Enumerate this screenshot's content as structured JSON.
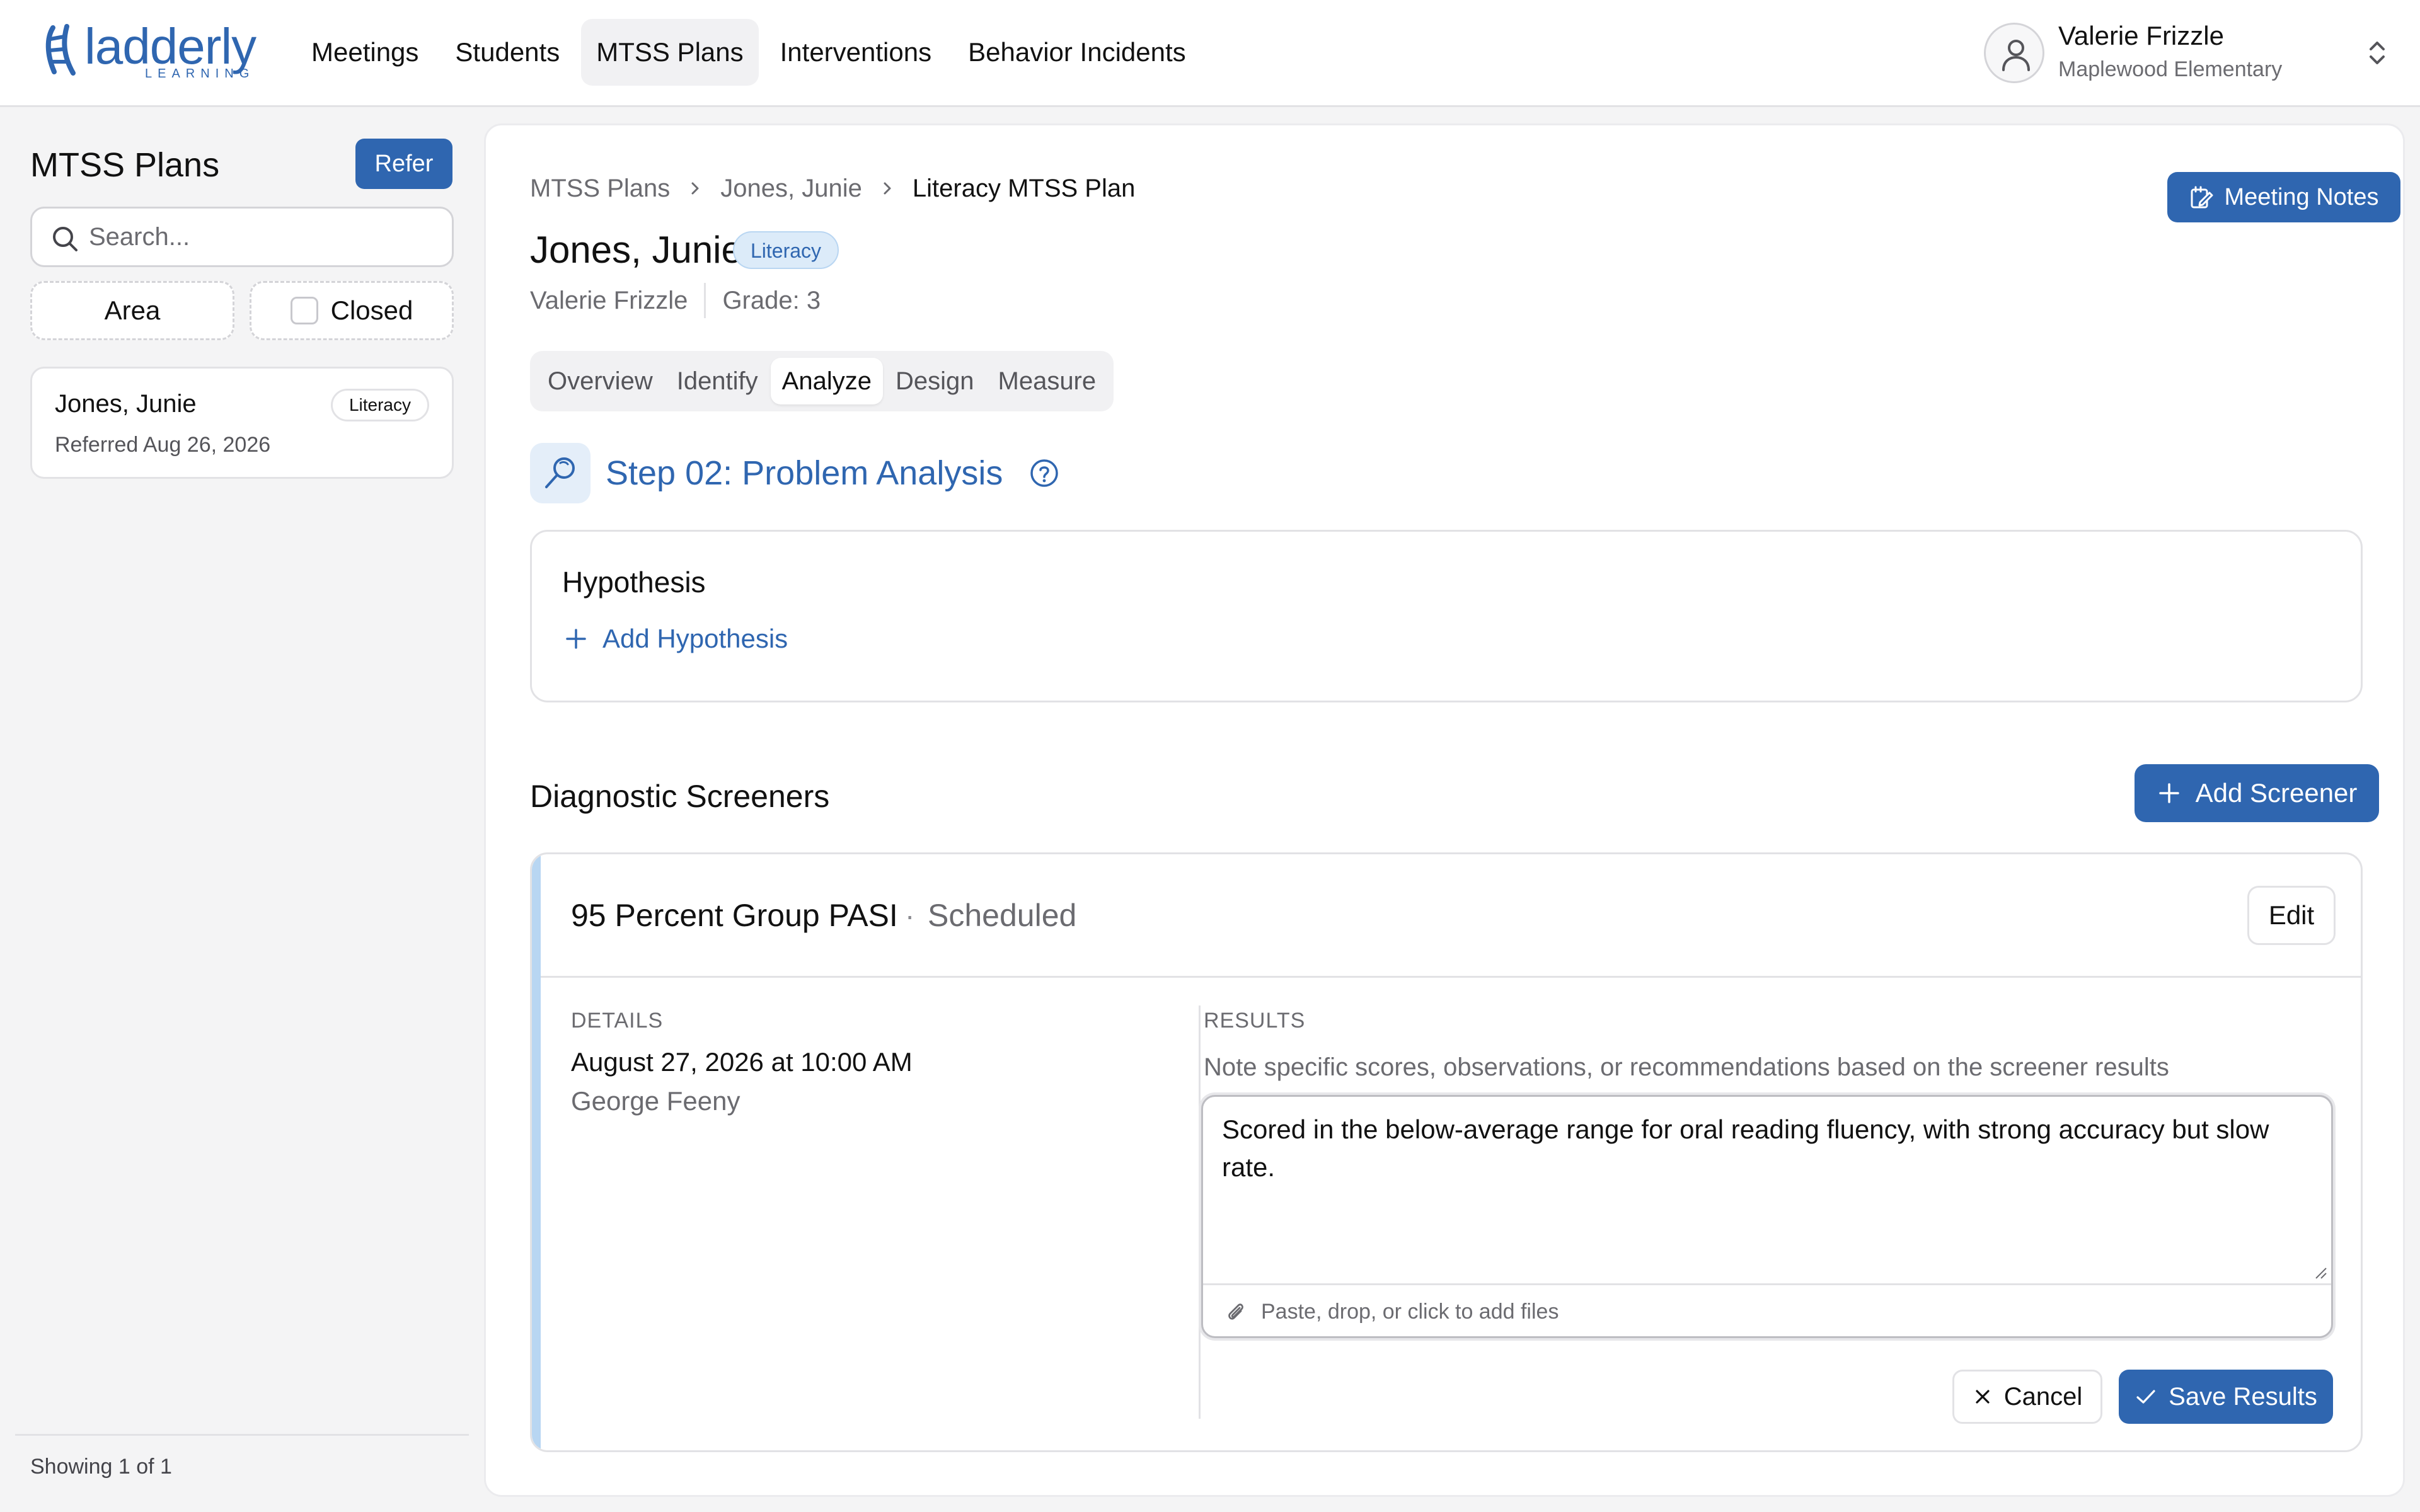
{
  "brand": {
    "name": "ladderly",
    "tagline": "LEARNING",
    "color": "#2f66b0"
  },
  "nav": {
    "items": [
      {
        "label": "Meetings"
      },
      {
        "label": "Students"
      },
      {
        "label": "MTSS Plans",
        "active": true
      },
      {
        "label": "Interventions"
      },
      {
        "label": "Behavior Incidents"
      }
    ]
  },
  "user": {
    "name": "Valerie Frizzle",
    "school": "Maplewood Elementary",
    "icon": "user-icon"
  },
  "sidebar": {
    "title": "MTSS Plans",
    "refer_label": "Refer",
    "search_placeholder": "Search...",
    "filters": {
      "area": "Area",
      "closed": "Closed",
      "closed_checked": false
    },
    "plans": [
      {
        "name": "Jones, Junie",
        "tag": "Literacy",
        "referred": "Referred Aug 26, 2026"
      }
    ],
    "footer": "Showing 1 of 1"
  },
  "main": {
    "breadcrumb": [
      "MTSS Plans",
      "Jones, Junie",
      "Literacy MTSS Plan"
    ],
    "meeting_notes_label": "Meeting Notes",
    "student_name": "Jones, Junie",
    "subject_badge": "Literacy",
    "teacher": "Valerie Frizzle",
    "grade": "Grade: 3",
    "tabs": [
      {
        "label": "Overview"
      },
      {
        "label": "Identify"
      },
      {
        "label": "Analyze",
        "active": true
      },
      {
        "label": "Design"
      },
      {
        "label": "Measure"
      }
    ],
    "step_title": "Step 02: Problem Analysis",
    "hypothesis": {
      "title": "Hypothesis",
      "add_label": "Add Hypothesis"
    },
    "diagnostics": {
      "title": "Diagnostic Screeners",
      "add_label": "Add Screener",
      "screener": {
        "name": "95 Percent Group PASI",
        "separator": "·",
        "status": "Scheduled",
        "edit_label": "Edit",
        "details_label": "DETAILS",
        "date": "August 27, 2026 at 10:00 AM",
        "person": "George Feeny",
        "results_label": "RESULTS",
        "results_help": "Note specific scores, observations, or recommendations based on the screener results",
        "results_text": "Scored in the below-average range for oral reading fluency, with strong accuracy but slow rate.",
        "attach_hint": "Paste, drop, or click to add files",
        "cancel_label": "Cancel",
        "save_label": "Save Results"
      }
    }
  },
  "colors": {
    "primary": "#2f66b0",
    "badge_bg": "#dcebf9",
    "accent_bar": "#b8d6f2"
  }
}
